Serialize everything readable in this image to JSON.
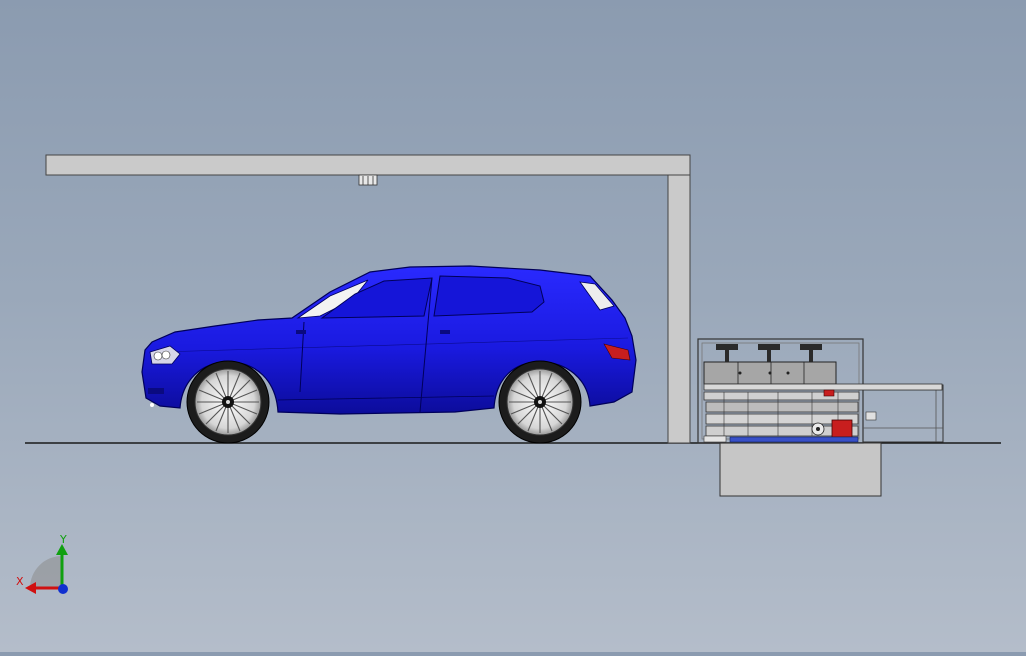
{
  "scene": {
    "background_top": "#8b9bb0",
    "background_bottom": "#b4bdca",
    "car_color": "#1515d8",
    "frame_color": "#c8c8c8",
    "station_color": "#cfcfcf",
    "accent_red": "#c81e1e"
  },
  "triad": {
    "x_label": "X",
    "y_label": "Y",
    "x_color": "#d01010",
    "y_color": "#10a010",
    "z_color": "#1030d0"
  }
}
